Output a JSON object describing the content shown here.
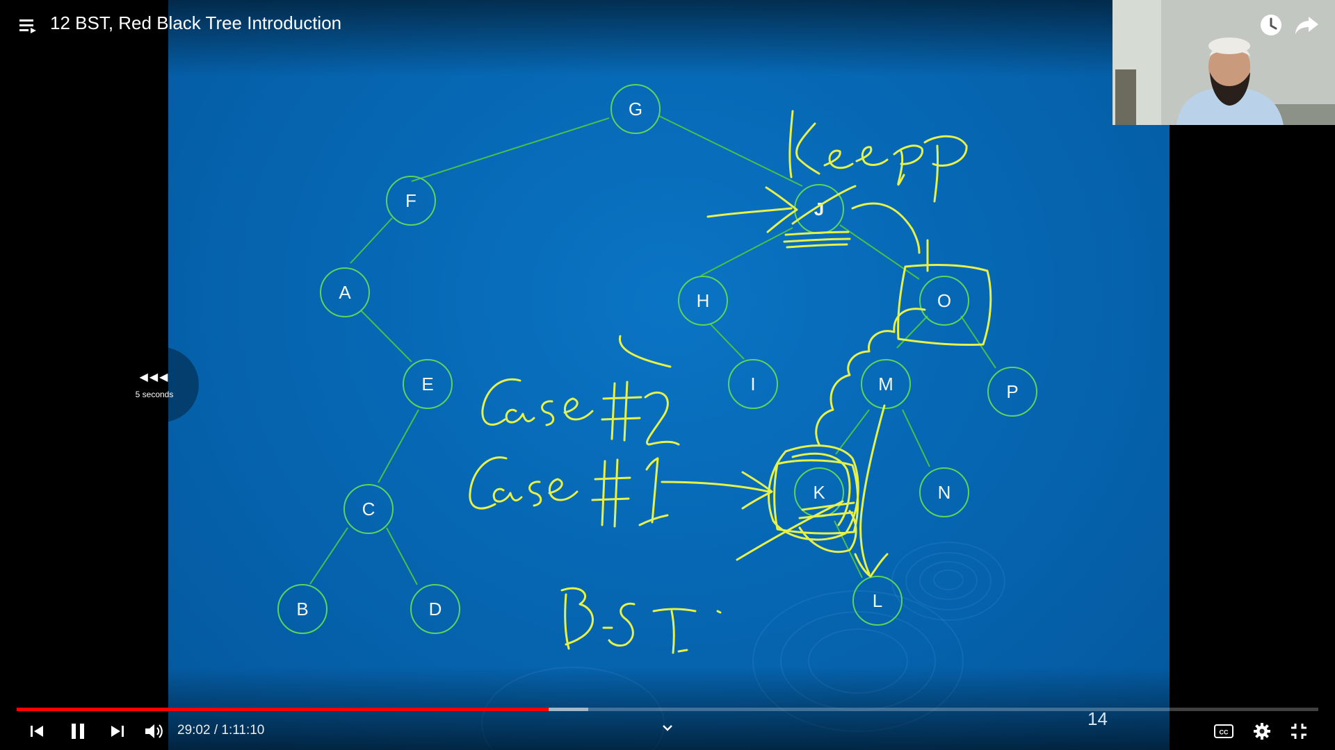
{
  "video": {
    "title": "12 BST, Red Black Tree Introduction",
    "current_time": "29:02 / 1:11:10",
    "progress": 0.4087,
    "buffered": 0.4392
  },
  "seek_overlay": {
    "label": "5 seconds",
    "arrows": "◀◀◀"
  },
  "slide": {
    "page_number": "14",
    "nodes": {
      "G": "G",
      "F": "F",
      "J": "J",
      "A": "A",
      "H": "H",
      "O": "O",
      "E": "E",
      "I": "I",
      "M": "M",
      "P": "P",
      "C": "C",
      "K": "K",
      "N": "N",
      "B": "B",
      "D": "D",
      "L": "L"
    }
  },
  "icons": {
    "playlist": "playlist-icon",
    "watch_later": "clock-icon",
    "share": "share-icon",
    "previous": "skip-previous-icon",
    "pause": "pause-icon",
    "next": "skip-next-icon",
    "volume": "volume-icon",
    "expand": "chevron-down-icon",
    "captions": "cc-icon",
    "settings": "gear-icon",
    "exit_fullscreen": "exit-fullscreen-icon"
  },
  "colors": {
    "progress_played": "#ff0000",
    "slide_background": "#0667b3",
    "tree_edge": "#5fd45a",
    "ink": "#e6f24a"
  }
}
